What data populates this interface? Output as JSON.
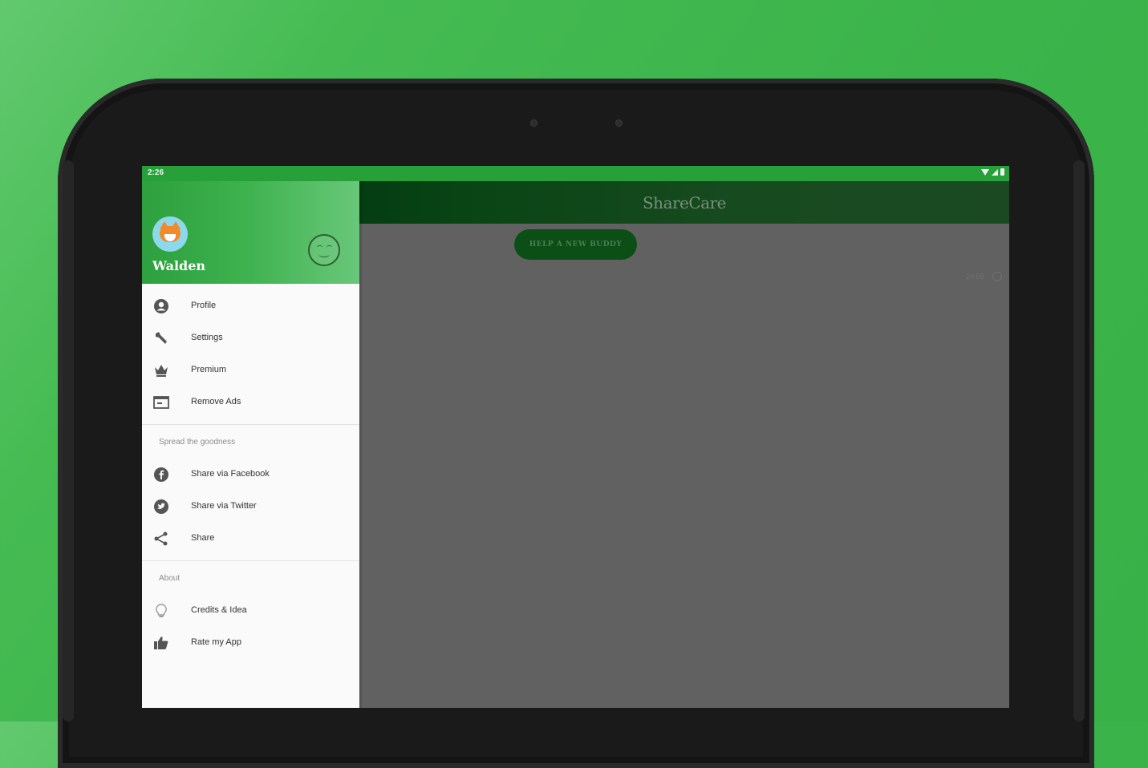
{
  "status_bar": {
    "time": "2:26"
  },
  "app": {
    "title": "ShareCare",
    "help_button": "HELP A NEW BUDDY"
  },
  "feed": {
    "time": "26:58"
  },
  "drawer": {
    "user_name": "Walden",
    "items": [
      {
        "label": "Profile",
        "icon": "account-circle-icon"
      },
      {
        "label": "Settings",
        "icon": "wrench-icon"
      },
      {
        "label": "Premium",
        "icon": "crown-icon"
      },
      {
        "label": "Remove Ads",
        "icon": "ad-remove-icon"
      }
    ],
    "section_share": "Spread the goodness",
    "share_items": [
      {
        "label": "Share via Facebook",
        "icon": "facebook-icon"
      },
      {
        "label": "Share via Twitter",
        "icon": "twitter-icon"
      },
      {
        "label": "Share",
        "icon": "share-icon"
      }
    ],
    "section_about": "About",
    "about_items": [
      {
        "label": "Credits & Idea",
        "icon": "lightbulb-icon"
      },
      {
        "label": "Rate my App",
        "icon": "thumbs-up-icon"
      }
    ]
  },
  "colors": {
    "background": "#3bb44a",
    "status_bar": "#27a03a",
    "app_bar_dimmed": "#184a20",
    "scrim": "#616161",
    "drawer": "#fafafa"
  }
}
